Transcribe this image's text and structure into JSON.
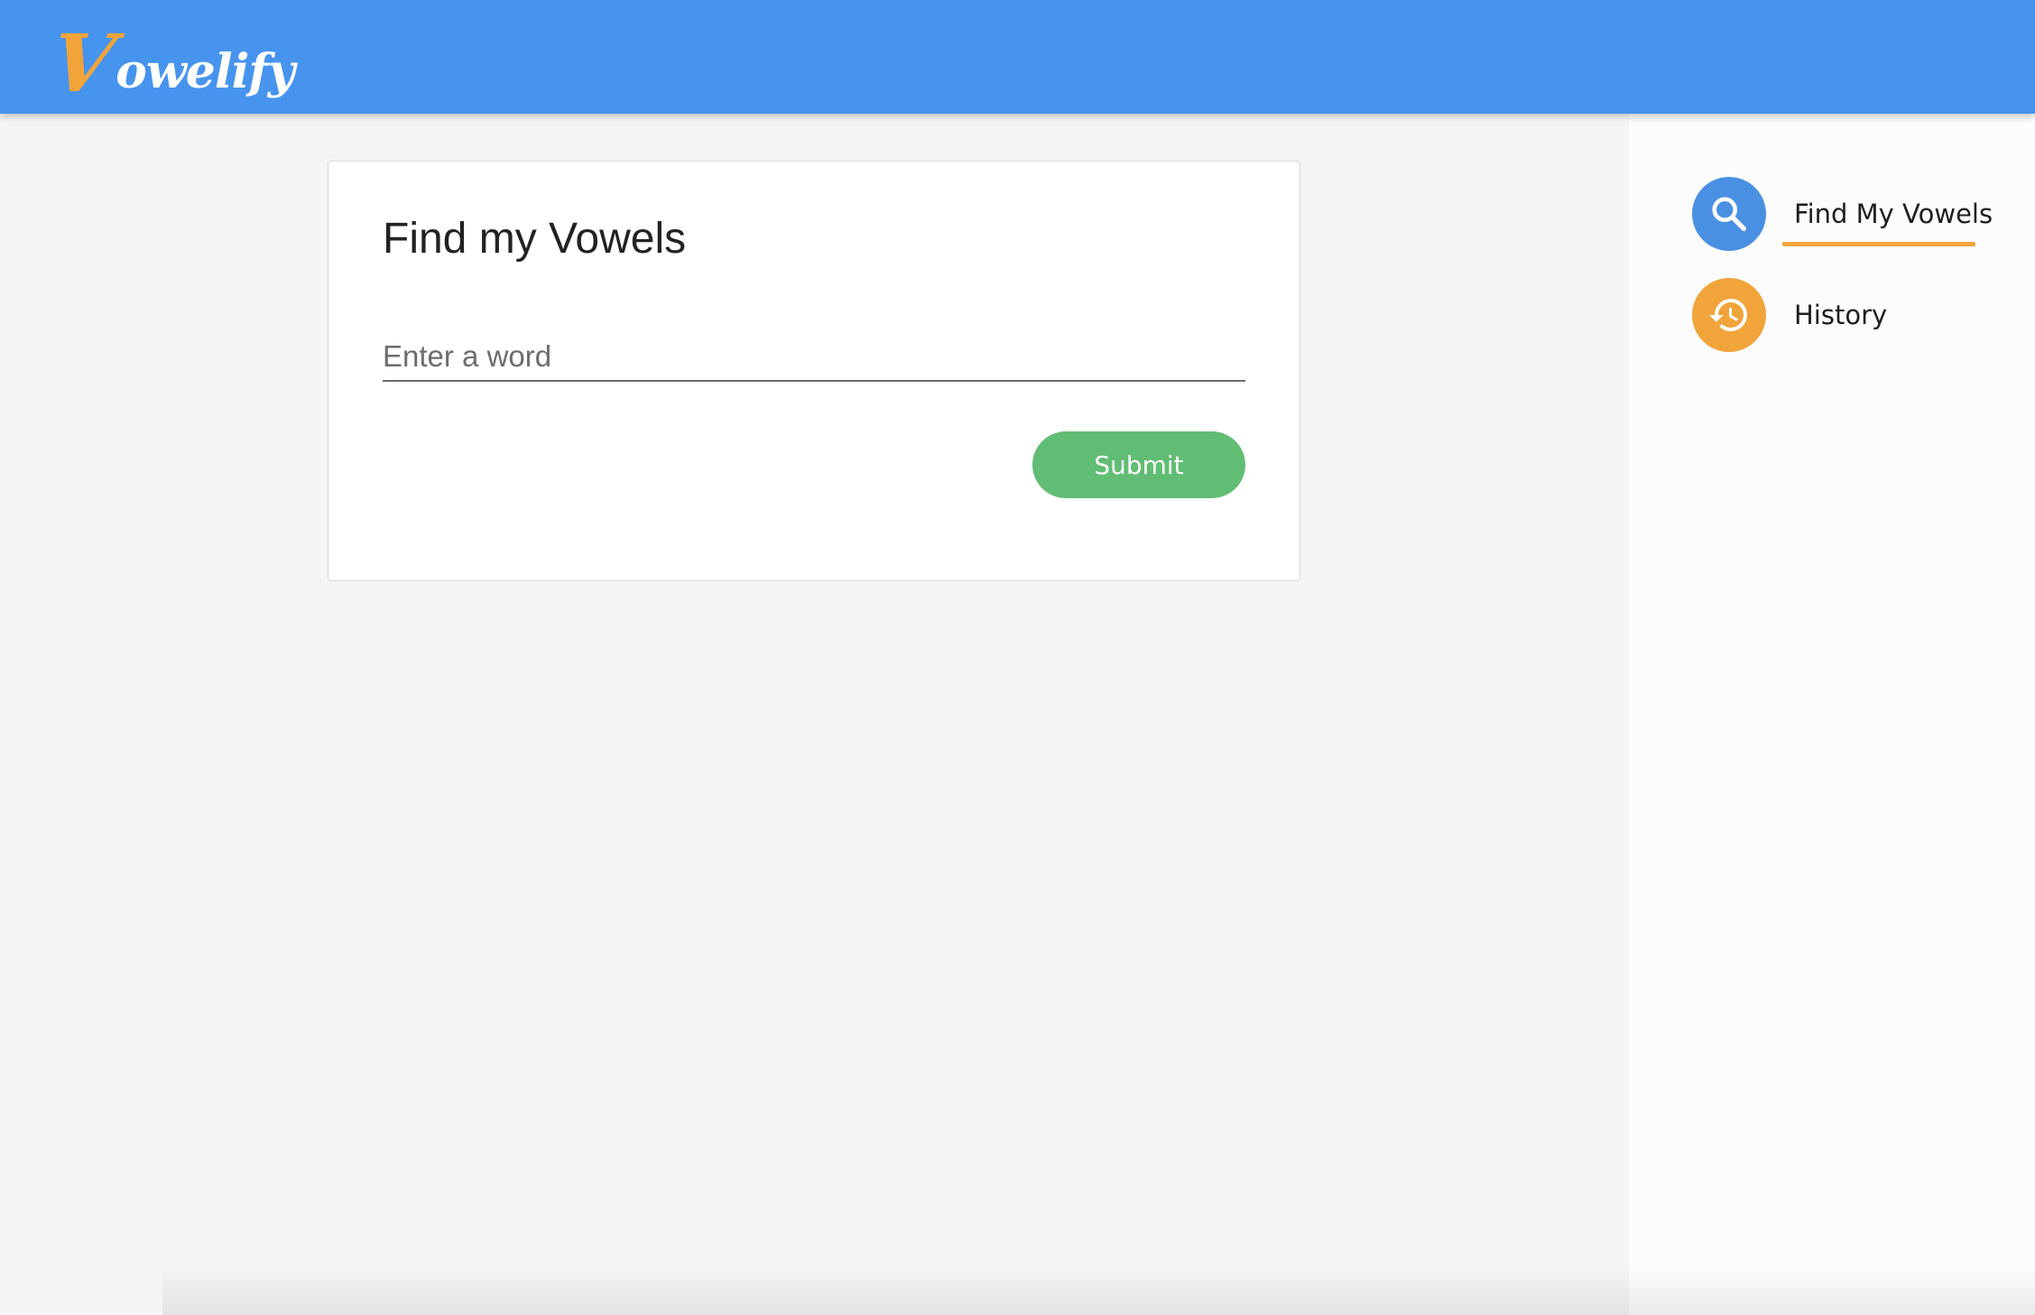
{
  "app": {
    "logo_initial": "V",
    "logo_rest": "owelify"
  },
  "card": {
    "title": "Find my Vowels",
    "input_placeholder": "Enter a word",
    "input_value": "",
    "submit_label": "Submit"
  },
  "sidebar": {
    "items": [
      {
        "label": "Find My Vowels",
        "icon": "search-icon",
        "color": "#4a90e2",
        "active": true
      },
      {
        "label": "History",
        "icon": "history-icon",
        "color": "#f1a43a",
        "active": false
      }
    ]
  },
  "colors": {
    "header": "#4694ee",
    "accent": "#f1a43a",
    "submit": "#61bd74",
    "background": "#f5f5f5"
  }
}
